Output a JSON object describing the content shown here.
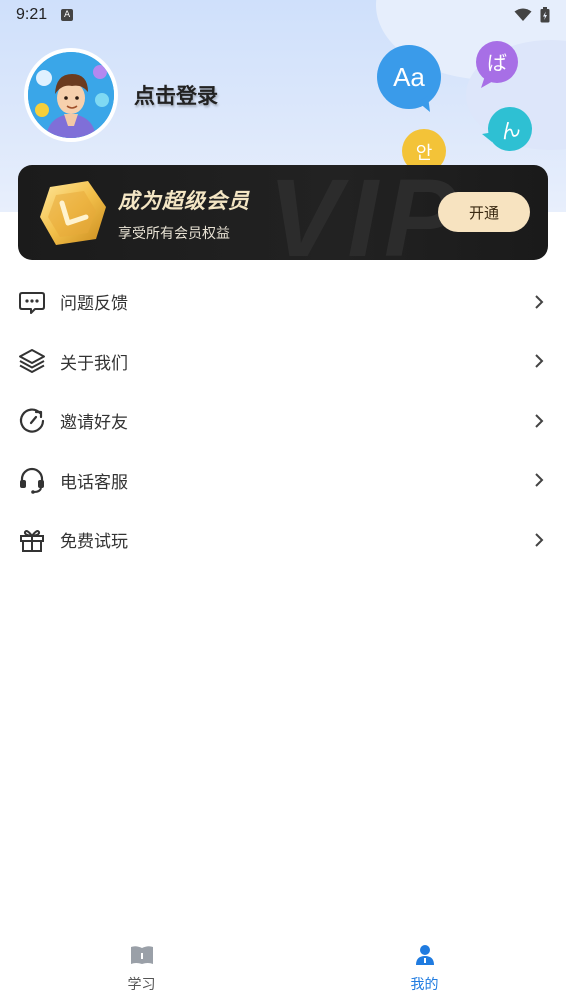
{
  "status_bar": {
    "time": "9:21",
    "notification_icon": "A"
  },
  "profile": {
    "login_label": "点击登录"
  },
  "bubbles": {
    "aa": "Aa",
    "ba": "ば",
    "ko": "안",
    "ru": "ん"
  },
  "vip": {
    "watermark": "VIP",
    "title": "成为超级会员",
    "subtitle": "享受所有会员权益",
    "button_label": "开通"
  },
  "menu": {
    "items": [
      {
        "label": "问题反馈",
        "icon": "feedback-icon"
      },
      {
        "label": "关于我们",
        "icon": "layers-icon"
      },
      {
        "label": "邀请好友",
        "icon": "refresh-icon"
      },
      {
        "label": "电话客服",
        "icon": "headset-icon"
      },
      {
        "label": "免费试玩",
        "icon": "gift-icon"
      }
    ]
  },
  "bottom_nav": {
    "items": [
      {
        "label": "学习",
        "icon": "book-icon",
        "active": false
      },
      {
        "label": "我的",
        "icon": "person-icon",
        "active": true
      }
    ]
  },
  "colors": {
    "accent": "#1f7be0",
    "vip_gold": "#f4e6c4",
    "vip_button": "#f7e3c0",
    "header_bg": "#cfe0fb"
  }
}
